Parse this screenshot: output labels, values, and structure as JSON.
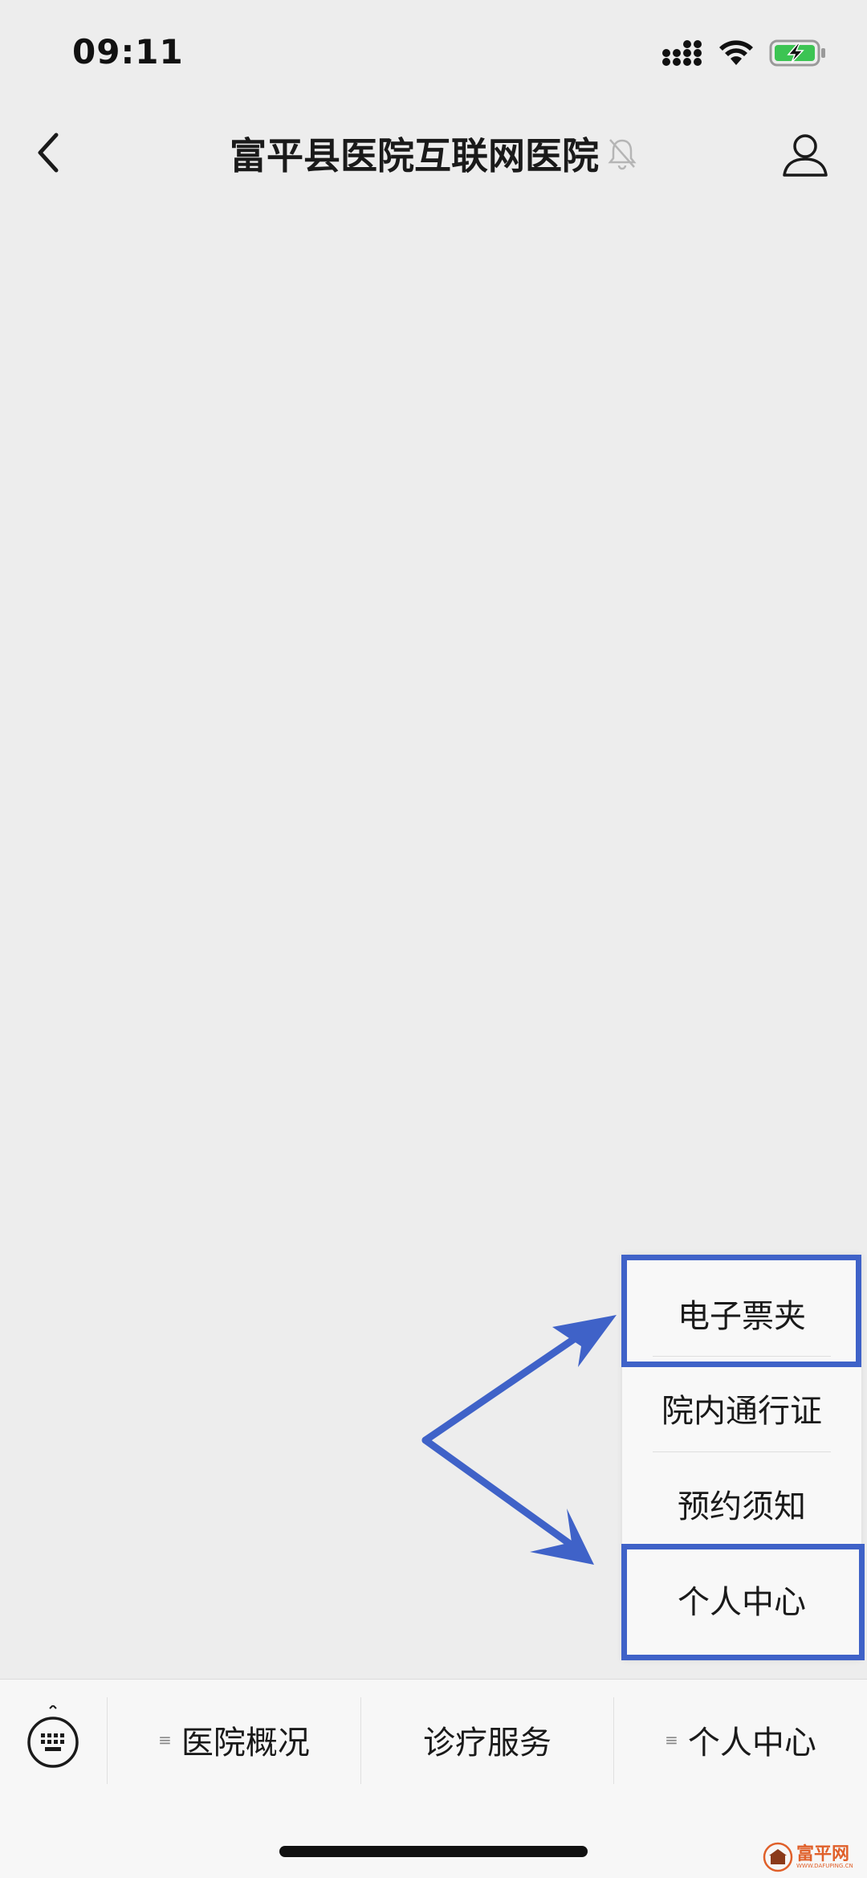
{
  "status_bar": {
    "time": "09:11",
    "icons": [
      "signal-icon",
      "wifi-icon",
      "battery-charging-icon"
    ],
    "battery_color": "#3cc453"
  },
  "nav": {
    "title": "富平县医院互联网医院",
    "icons": [
      "back-icon",
      "muted-bell-icon",
      "profile-icon"
    ]
  },
  "popup_menu": {
    "items": [
      {
        "label": "电子票夹",
        "highlighted": true
      },
      {
        "label": "院内通行证",
        "highlighted": false
      },
      {
        "label": "预约须知",
        "highlighted": false
      },
      {
        "label": "个人中心",
        "highlighted": true
      }
    ]
  },
  "bottom_menu": {
    "keyboard_icon": "keyboard-icon",
    "items": [
      {
        "label": "医院概况",
        "has_submenu": true
      },
      {
        "label": "诊疗服务",
        "has_submenu": false
      },
      {
        "label": "个人中心",
        "has_submenu": true
      }
    ]
  },
  "annotation": {
    "color": "#3f62c8"
  },
  "watermark": {
    "text": "富平网",
    "sub": "WWW.DAFUPING.CN"
  }
}
